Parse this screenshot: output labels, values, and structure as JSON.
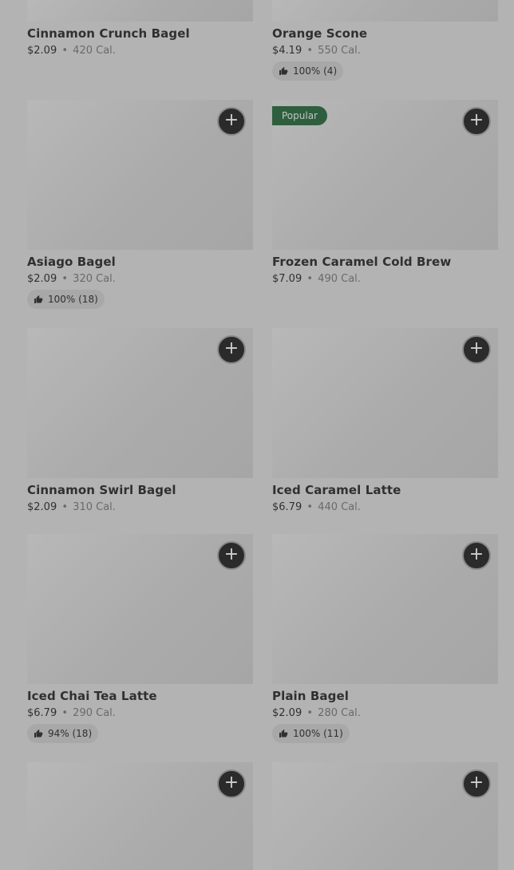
{
  "rows": [
    {
      "items": [
        {
          "name": "Cinnamon Crunch Bagel",
          "price": "$2.09",
          "separator": "•",
          "calories": "420 Cal.",
          "rating": null,
          "popular": false
        },
        {
          "name": "Orange Scone",
          "price": "$4.19",
          "separator": "•",
          "calories": "550 Cal.",
          "rating": "100% (4)",
          "popular": false
        }
      ]
    },
    {
      "items": [
        {
          "name": "Asiago Bagel",
          "price": "$2.09",
          "separator": "•",
          "calories": "320 Cal.",
          "rating": "100% (18)",
          "popular": false
        },
        {
          "name": "Frozen Caramel Cold Brew",
          "price": "$7.09",
          "separator": "•",
          "calories": "490 Cal.",
          "rating": null,
          "popular": true
        }
      ]
    },
    {
      "items": [
        {
          "name": "Cinnamon Swirl Bagel",
          "price": "$2.09",
          "separator": "•",
          "calories": "310 Cal.",
          "rating": null,
          "popular": false
        },
        {
          "name": "Iced Caramel Latte",
          "price": "$6.79",
          "separator": "•",
          "calories": "440 Cal.",
          "rating": null,
          "popular": false
        }
      ]
    },
    {
      "items": [
        {
          "name": "Iced Chai Tea Latte",
          "price": "$6.79",
          "separator": "•",
          "calories": "290 Cal.",
          "rating": "94% (18)",
          "popular": false
        },
        {
          "name": "Plain Bagel",
          "price": "$2.09",
          "separator": "•",
          "calories": "280 Cal.",
          "rating": "100% (11)",
          "popular": false
        }
      ]
    }
  ],
  "popular_label": "Popular",
  "add_button_symbol": "+",
  "icons": {
    "add": "plus-icon",
    "rating": "thumbs-up-icon"
  },
  "colors": {
    "add_button_bg": "#2b2b2b",
    "popular_badge_bg": "#2f5e3e",
    "rating_pill_bg": "#a8a8a8"
  }
}
